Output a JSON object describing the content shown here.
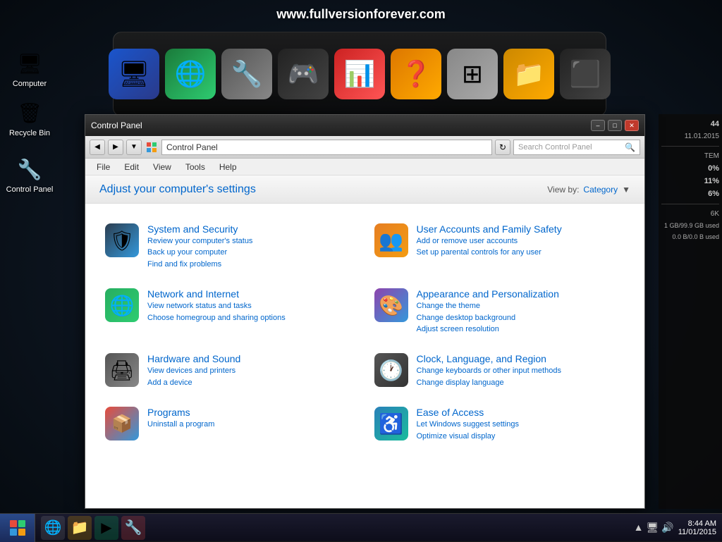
{
  "watermark": "www.fullversionforever.com",
  "desktop_icons": [
    {
      "id": "computer",
      "label": "Computer",
      "icon": "🖥"
    },
    {
      "id": "recycle-bin",
      "label": "Recycle Bin",
      "icon": "🗑"
    },
    {
      "id": "control-panel",
      "label": "Control Panel",
      "icon": "🔧"
    }
  ],
  "dock_items": [
    {
      "id": "monitor",
      "bg": "#2255aa",
      "icon": "🖥"
    },
    {
      "id": "globe",
      "bg": "#1a7a3a",
      "icon": "🌐"
    },
    {
      "id": "tools",
      "bg": "#555",
      "icon": "🔧"
    },
    {
      "id": "gamepad",
      "bg": "#222",
      "icon": "🎮"
    },
    {
      "id": "pie-chart",
      "bg": "#cc2222",
      "icon": "📊"
    },
    {
      "id": "help",
      "bg": "#dd7700",
      "icon": "❓"
    },
    {
      "id": "windows",
      "bg": "#aaa",
      "icon": "⊞"
    },
    {
      "id": "folder",
      "bg": "#cc8800",
      "icon": "📁"
    },
    {
      "id": "black-box",
      "bg": "#333",
      "icon": "⬛"
    }
  ],
  "window": {
    "title": "Control Panel",
    "min_label": "–",
    "max_label": "□",
    "close_label": "✕"
  },
  "address": {
    "back": "◀",
    "forward": "▶",
    "recent": "▼",
    "path": "Control Panel",
    "search_placeholder": "Search Control Panel",
    "search_icon": "▶"
  },
  "menu": {
    "items": [
      "File",
      "Edit",
      "View",
      "Tools",
      "Help"
    ]
  },
  "header": {
    "title": "Adjust your computer's settings",
    "view_by_label": "View by:",
    "view_by_value": "Category",
    "view_by_arrow": "▼"
  },
  "sections": [
    {
      "id": "system-security",
      "title": "System and Security",
      "icon": "🛡",
      "icon_class": "icon-system",
      "links": [
        "Review your computer's status",
        "Back up your computer",
        "Find and fix problems"
      ]
    },
    {
      "id": "user-accounts",
      "title": "User Accounts and Family Safety",
      "icon": "👥",
      "icon_class": "icon-user",
      "links": [
        "Add or remove user accounts",
        "Set up parental controls for any user"
      ]
    },
    {
      "id": "network-internet",
      "title": "Network and Internet",
      "icon": "🌐",
      "icon_class": "icon-network",
      "links": [
        "View network status and tasks",
        "Choose homegroup and sharing options"
      ]
    },
    {
      "id": "appearance",
      "title": "Appearance and Personalization",
      "icon": "🎨",
      "icon_class": "icon-appearance",
      "links": [
        "Change the theme",
        "Change desktop background",
        "Adjust screen resolution"
      ]
    },
    {
      "id": "hardware-sound",
      "title": "Hardware and Sound",
      "icon": "🖨",
      "icon_class": "icon-hardware",
      "links": [
        "View devices and printers",
        "Add a device"
      ]
    },
    {
      "id": "clock-language",
      "title": "Clock, Language, and Region",
      "icon": "🕐",
      "icon_class": "icon-clock",
      "links": [
        "Change keyboards or other input methods",
        "Change display language"
      ]
    },
    {
      "id": "programs",
      "title": "Programs",
      "icon": "📦",
      "icon_class": "icon-programs",
      "links": [
        "Uninstall a program"
      ]
    },
    {
      "id": "ease-of-access",
      "title": "Ease of Access",
      "icon": "♿",
      "icon_class": "icon-ease",
      "links": [
        "Let Windows suggest settings",
        "Optimize visual display"
      ]
    }
  ],
  "right_panel": {
    "time": "44",
    "date": "11.01.2015",
    "label_tem": "TEM",
    "val1": "0%",
    "val2": "11%",
    "val3": "6%",
    "storage": "6K",
    "disk_used": "1 GB/99.9 GB used",
    "io": "0.0 B/0.0 B used"
  },
  "taskbar": {
    "start_icon": "⊞",
    "icons": [
      "🌐",
      "📁",
      "▶",
      "🔧"
    ],
    "time": "8:44 AM",
    "date": "11/01/2015",
    "sys_icons": [
      "▲",
      "🖥",
      "🔊"
    ]
  }
}
